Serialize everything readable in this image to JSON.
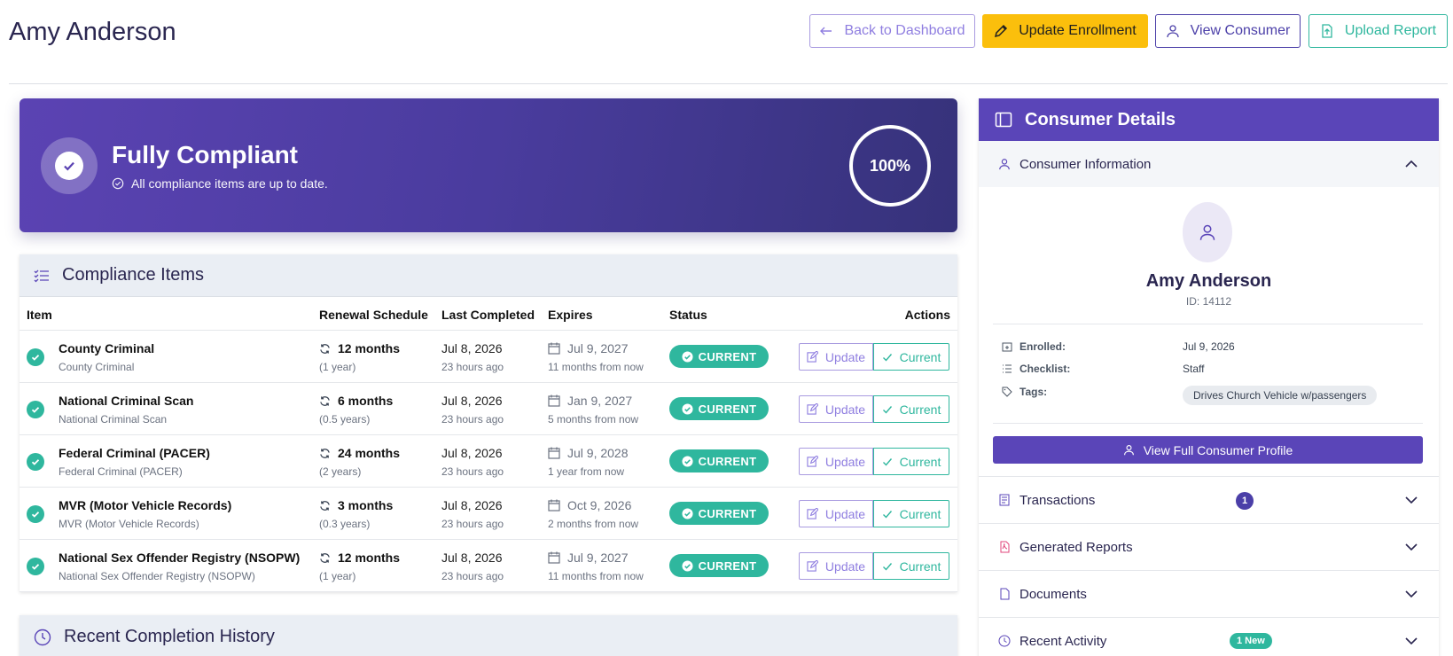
{
  "page": {
    "title": "Amy Anderson"
  },
  "toolbar": {
    "back": "Back to Dashboard",
    "update": "Update Enrollment",
    "view_consumer": "View Consumer",
    "upload": "Upload Report"
  },
  "hero": {
    "title": "Fully Compliant",
    "subtitle": "All compliance items are up to date.",
    "percent": "100%"
  },
  "compliance": {
    "title": "Compliance Items",
    "columns": {
      "item": "Item",
      "renewal": "Renewal Schedule",
      "last": "Last Completed",
      "expires": "Expires",
      "status": "Status",
      "actions": "Actions"
    },
    "rows": [
      {
        "name": "County Criminal",
        "sub": "County Criminal",
        "renewal": "12 months",
        "renewal_sub": "(1 year)",
        "last": "Jul 8, 2026",
        "last_sub": "23 hours ago",
        "expires": "Jul 9, 2027",
        "expires_sub": "11 months from now",
        "status": "CURRENT",
        "update": "Update",
        "current": "Current"
      },
      {
        "name": "National Criminal Scan",
        "sub": "National Criminal Scan",
        "renewal": "6 months",
        "renewal_sub": "(0.5 years)",
        "last": "Jul 8, 2026",
        "last_sub": "23 hours ago",
        "expires": "Jan 9, 2027",
        "expires_sub": "5 months from now",
        "status": "CURRENT",
        "update": "Update",
        "current": "Current"
      },
      {
        "name": "Federal Criminal (PACER)",
        "sub": "Federal Criminal (PACER)",
        "renewal": "24 months",
        "renewal_sub": "(2 years)",
        "last": "Jul 8, 2026",
        "last_sub": "23 hours ago",
        "expires": "Jul 9, 2028",
        "expires_sub": "1 year from now",
        "status": "CURRENT",
        "update": "Update",
        "current": "Current"
      },
      {
        "name": "MVR (Motor Vehicle Records)",
        "sub": "MVR (Motor Vehicle Records)",
        "renewal": "3 months",
        "renewal_sub": "(0.3 years)",
        "last": "Jul 8, 2026",
        "last_sub": "23 hours ago",
        "expires": "Oct 9, 2026",
        "expires_sub": "2 months from now",
        "status": "CURRENT",
        "update": "Update",
        "current": "Current"
      },
      {
        "name": "National Sex Offender Registry (NSOPW)",
        "sub": "National Sex Offender Registry (NSOPW)",
        "renewal": "12 months",
        "renewal_sub": "(1 year)",
        "last": "Jul 8, 2026",
        "last_sub": "23 hours ago",
        "expires": "Jul 9, 2027",
        "expires_sub": "11 months from now",
        "status": "CURRENT",
        "update": "Update",
        "current": "Current"
      }
    ]
  },
  "history": {
    "title": "Recent Completion History"
  },
  "sidebar": {
    "title": "Consumer Details",
    "info_section": "Consumer Information",
    "name": "Amy Anderson",
    "id": "ID: 14112",
    "enrolled_label": "Enrolled:",
    "enrolled": "Jul 9, 2026",
    "checklist_label": "Checklist:",
    "checklist": "Staff",
    "tags_label": "Tags:",
    "tag": "Drives Church Vehicle w/passengers",
    "full_profile": "View Full Consumer Profile",
    "transactions": "Transactions",
    "transactions_count": "1",
    "reports": "Generated Reports",
    "documents": "Documents",
    "activity": "Recent Activity",
    "activity_badge": "1 New"
  },
  "colors": {
    "primary": "#5a45b8",
    "success": "#2fb79e",
    "warning": "#fbbf0c"
  }
}
